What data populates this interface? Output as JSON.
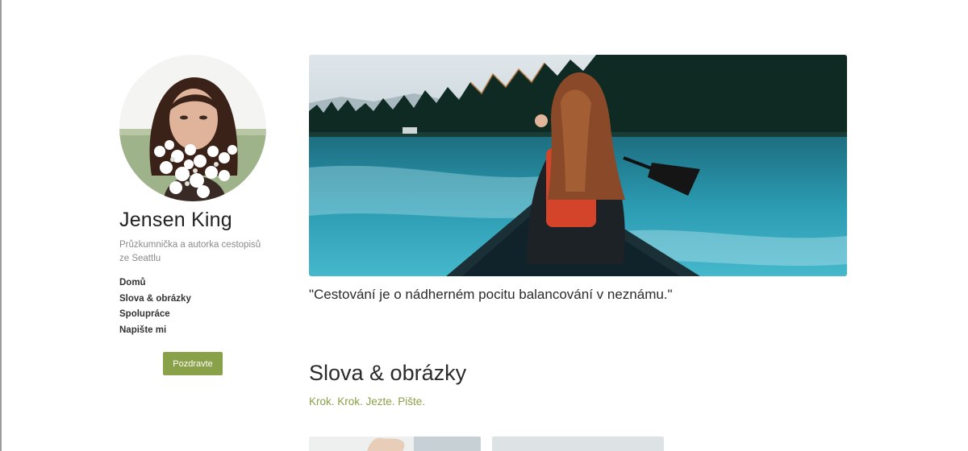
{
  "profile": {
    "name": "Jensen King",
    "bio": "Průzkumnička a autorka cestopisů ze Seattlu"
  },
  "nav": {
    "items": [
      {
        "label": "Domů"
      },
      {
        "label": "Slova & obrázky"
      },
      {
        "label": "Spolupráce"
      },
      {
        "label": "Napište mi"
      }
    ]
  },
  "cta": {
    "label": "Pozdravte"
  },
  "hero": {
    "quote": "\"Cestování je o nádherném pocitu balancování v neznámu.\""
  },
  "section": {
    "title": "Slova & obrázky",
    "subtitle": "Krok. Krok. Jezte. Pište."
  },
  "colors": {
    "accent": "#89a148",
    "text": "#2b2b2b",
    "muted": "#8a8a8a"
  }
}
